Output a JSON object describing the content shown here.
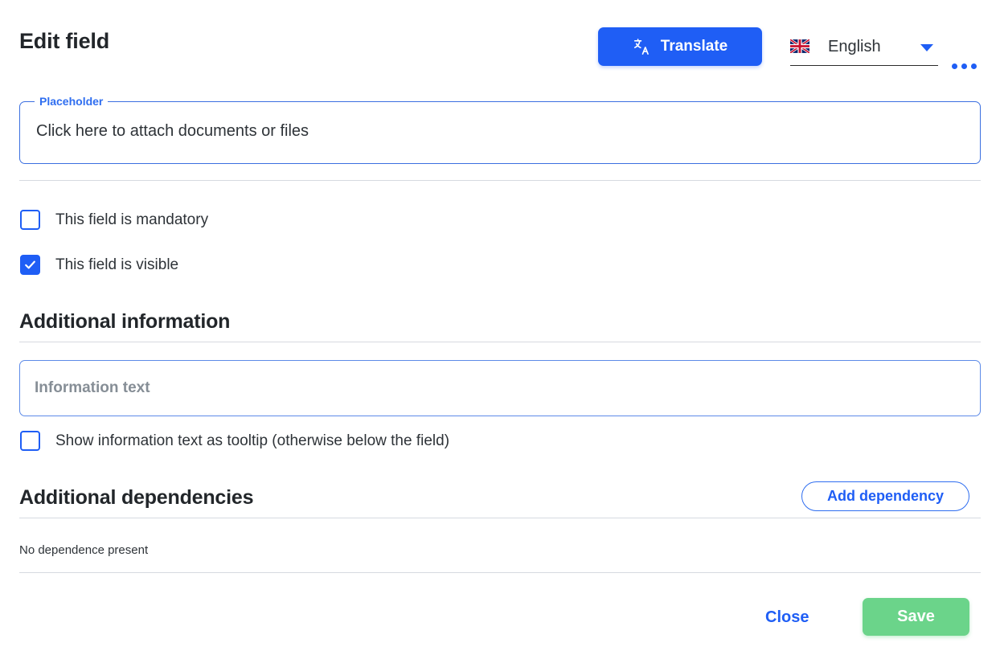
{
  "header": {
    "title": "Edit field",
    "translate_label": "Translate",
    "translate_icon": "translate-icon",
    "language": {
      "value": "English",
      "flag_icon": "uk-flag-icon",
      "caret_icon": "chevron-down-icon"
    },
    "more_icon": "more-options-icon"
  },
  "placeholder_field": {
    "legend": "Placeholder",
    "value": "Click here to attach documents or files"
  },
  "options": [
    {
      "label": "This field is mandatory",
      "checked": false
    },
    {
      "label": "This field is visible",
      "checked": true
    }
  ],
  "additional_information": {
    "heading": "Additional information",
    "info_text_value": "",
    "info_text_placeholder": "Information text",
    "tooltip_option": {
      "label": "Show information text as tooltip (otherwise below the field)",
      "checked": false
    }
  },
  "additional_dependencies": {
    "heading": "Additional dependencies",
    "add_button_label": "Add dependency",
    "empty_text": "No dependence present"
  },
  "footer": {
    "close_label": "Close",
    "save_label": "Save"
  },
  "colors": {
    "accent_blue": "#1f5ef5",
    "save_green": "#6bd48a",
    "text_dark": "#22262a",
    "muted_text": "#868e96",
    "divider": "#d6dae0"
  }
}
